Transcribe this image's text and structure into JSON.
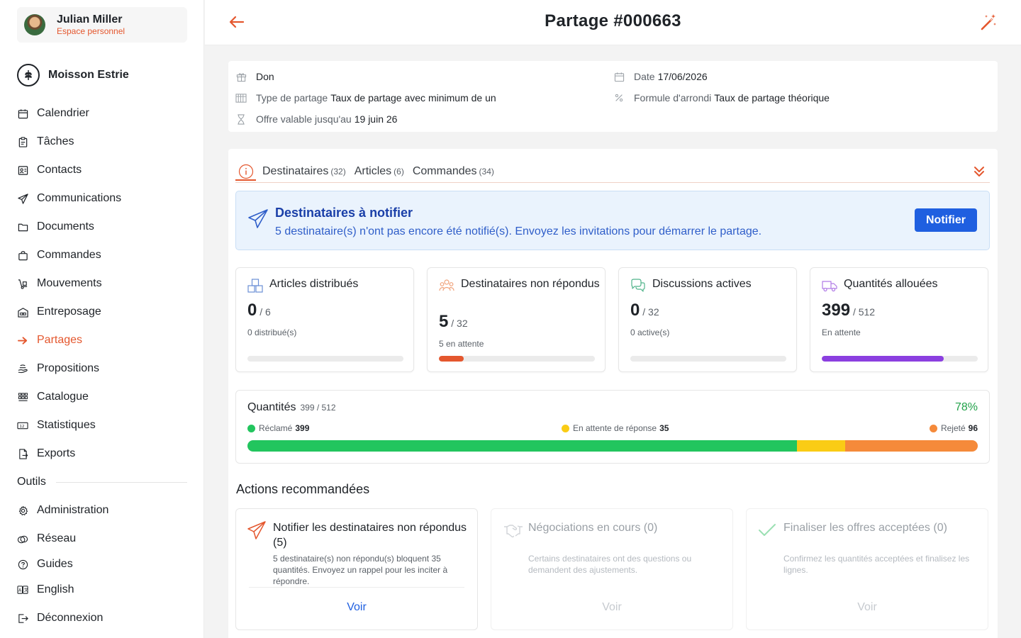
{
  "user": {
    "name": "Julian Miller",
    "subtitle": "Espace personnel"
  },
  "org": {
    "name": "Moisson Estrie"
  },
  "nav": {
    "items": [
      {
        "label": "Calendrier",
        "icon": "calendar-icon"
      },
      {
        "label": "Tâches",
        "icon": "clipboard-icon"
      },
      {
        "label": "Contacts",
        "icon": "contact-card-icon"
      },
      {
        "label": "Communications",
        "icon": "paper-plane-icon"
      },
      {
        "label": "Documents",
        "icon": "folder-icon"
      },
      {
        "label": "Commandes",
        "icon": "shopping-bag-icon"
      },
      {
        "label": "Mouvements",
        "icon": "hand-truck-icon"
      },
      {
        "label": "Entreposage",
        "icon": "warehouse-icon"
      },
      {
        "label": "Partages",
        "icon": "arrow-right-icon",
        "active": true
      },
      {
        "label": "Propositions",
        "icon": "hand-offer-icon"
      },
      {
        "label": "Catalogue",
        "icon": "grid-icon"
      },
      {
        "label": "Statistiques",
        "icon": "numbers-icon"
      },
      {
        "label": "Exports",
        "icon": "file-export-icon"
      }
    ],
    "section": "Outils",
    "tools": [
      {
        "label": "Administration",
        "icon": "gear-icon"
      },
      {
        "label": "Réseau",
        "icon": "network-icon"
      },
      {
        "label": "Guides",
        "icon": "help-icon"
      },
      {
        "label": "English",
        "icon": "language-icon"
      },
      {
        "label": "Déconnexion",
        "icon": "logout-icon"
      }
    ]
  },
  "header": {
    "title": "Partage #000663"
  },
  "info": {
    "type_value": "Don",
    "date_label": "Date",
    "date_value": "17/06/2026",
    "share_type_label": "Type de partage",
    "share_type_value": "Taux de partage avec minimum de un",
    "rounding_label": "Formule d'arrondi",
    "rounding_value": "Taux de partage théorique",
    "valid_label": "Offre valable jusqu'au",
    "valid_value": "19 juin 26"
  },
  "tabs": [
    {
      "label": "Destinataires",
      "count": "(32)"
    },
    {
      "label": "Articles",
      "count": "(6)"
    },
    {
      "label": "Commandes",
      "count": "(34)"
    }
  ],
  "notify": {
    "title": "Destinataires à notifier",
    "text": "5 destinataire(s) n'ont pas encore été notifié(s). Envoyez les invitations pour démarrer le partage.",
    "button": "Notifier"
  },
  "stats": [
    {
      "title": "Articles distribués",
      "value": "0",
      "total": "/ 6",
      "sub": "0 distribué(s)",
      "progress": 0,
      "color": "#dcdcdc",
      "icon": "boxes-icon"
    },
    {
      "title": "Destinataires non répondus",
      "value": "5",
      "total": "/ 32",
      "sub": "5 en attente",
      "progress": 0.16,
      "color": "#e4572e",
      "icon": "users-icon"
    },
    {
      "title": "Discussions actives",
      "value": "0",
      "total": "/ 32",
      "sub": "0 active(s)",
      "progress": 0,
      "color": "#dcdcdc",
      "icon": "chat-icon"
    },
    {
      "title": "Quantités allouées",
      "value": "399",
      "total": "/ 512",
      "sub": "En attente",
      "progress": 0.78,
      "color": "#8b3fe0",
      "icon": "delivery-truck-icon"
    }
  ],
  "quantities": {
    "title": "Quantités",
    "count": "399 / 512",
    "percent": "78%",
    "claimed_label": "Réclamé",
    "claimed_value": "399",
    "pending_label": "En attente de réponse",
    "pending_value": "35",
    "rejected_label": "Rejeté",
    "rejected_value": "96",
    "total": 512,
    "colors": {
      "claimed": "#22c55e",
      "pending": "#facc15",
      "rejected": "#f58a3a"
    }
  },
  "actions": {
    "title": "Actions recommandées",
    "items": [
      {
        "title": "Notifier les destinataires non répondus (5)",
        "desc": "5 destinataire(s) non répondu(s) bloquent 35 quantités. Envoyez un rappel pour les inciter à répondre.",
        "button": "Voir",
        "enabled": true,
        "icon": "paper-plane-icon"
      },
      {
        "title": "Négociations en cours (0)",
        "desc": "Certains destinataires ont des questions ou demandent des ajustements.",
        "button": "Voir",
        "enabled": false,
        "icon": "handshake-icon"
      },
      {
        "title": "Finaliser les offres acceptées (0)",
        "desc": "Confirmez les quantités acceptées et finalisez les lignes.",
        "button": "Voir",
        "enabled": false,
        "icon": "checkmark-icon"
      }
    ]
  },
  "colors": {
    "accent": "#e4572e",
    "primary": "#1f5fe0",
    "success": "#22a24a"
  }
}
